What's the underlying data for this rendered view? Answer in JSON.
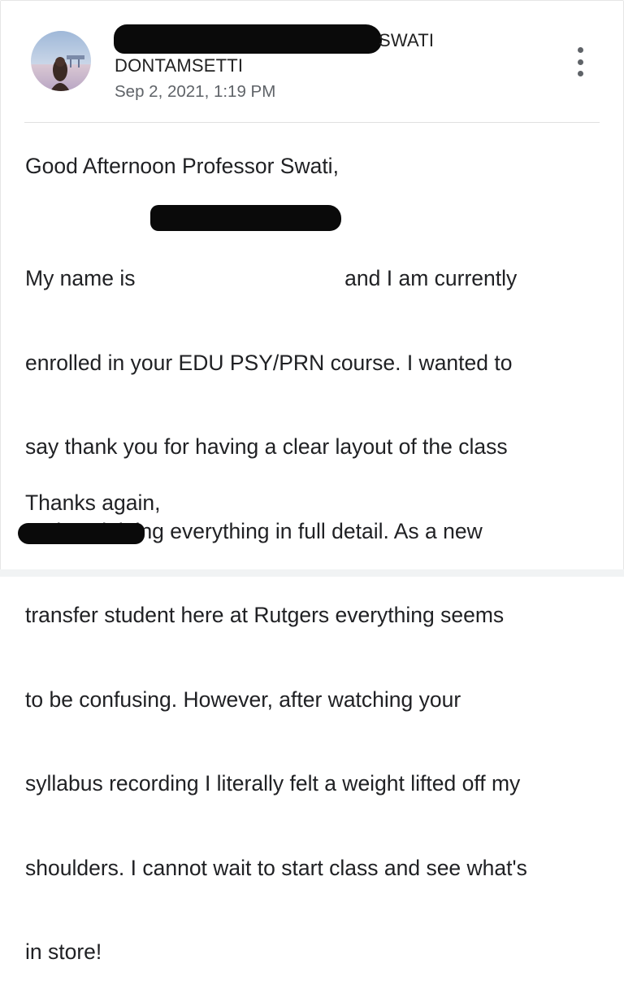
{
  "email": {
    "sender": {
      "name_visible_part1": "SWATI",
      "name_visible_part2": "DONTAMSETTI",
      "avatar_icon": "profile-photo"
    },
    "timestamp": "Sep 2, 2021, 1:19 PM",
    "menu_icon": "more-vert-icon",
    "body": {
      "greeting": "Good Afternoon Professor Swati,",
      "paragraph_lines": [
        "My name is                                   and I am currently",
        "enrolled in your EDU PSY/PRN course. I wanted to",
        "say thank you for having a clear layout of the class",
        "and explaining everything in full detail. As a new",
        "transfer student here at Rutgers everything seems",
        "to be confusing. However, after watching your",
        "syllabus recording I literally felt a weight lifted off my",
        "shoulders. I cannot wait to start class and see what's",
        "in store!"
      ],
      "signoff": "Thanks again,"
    }
  }
}
